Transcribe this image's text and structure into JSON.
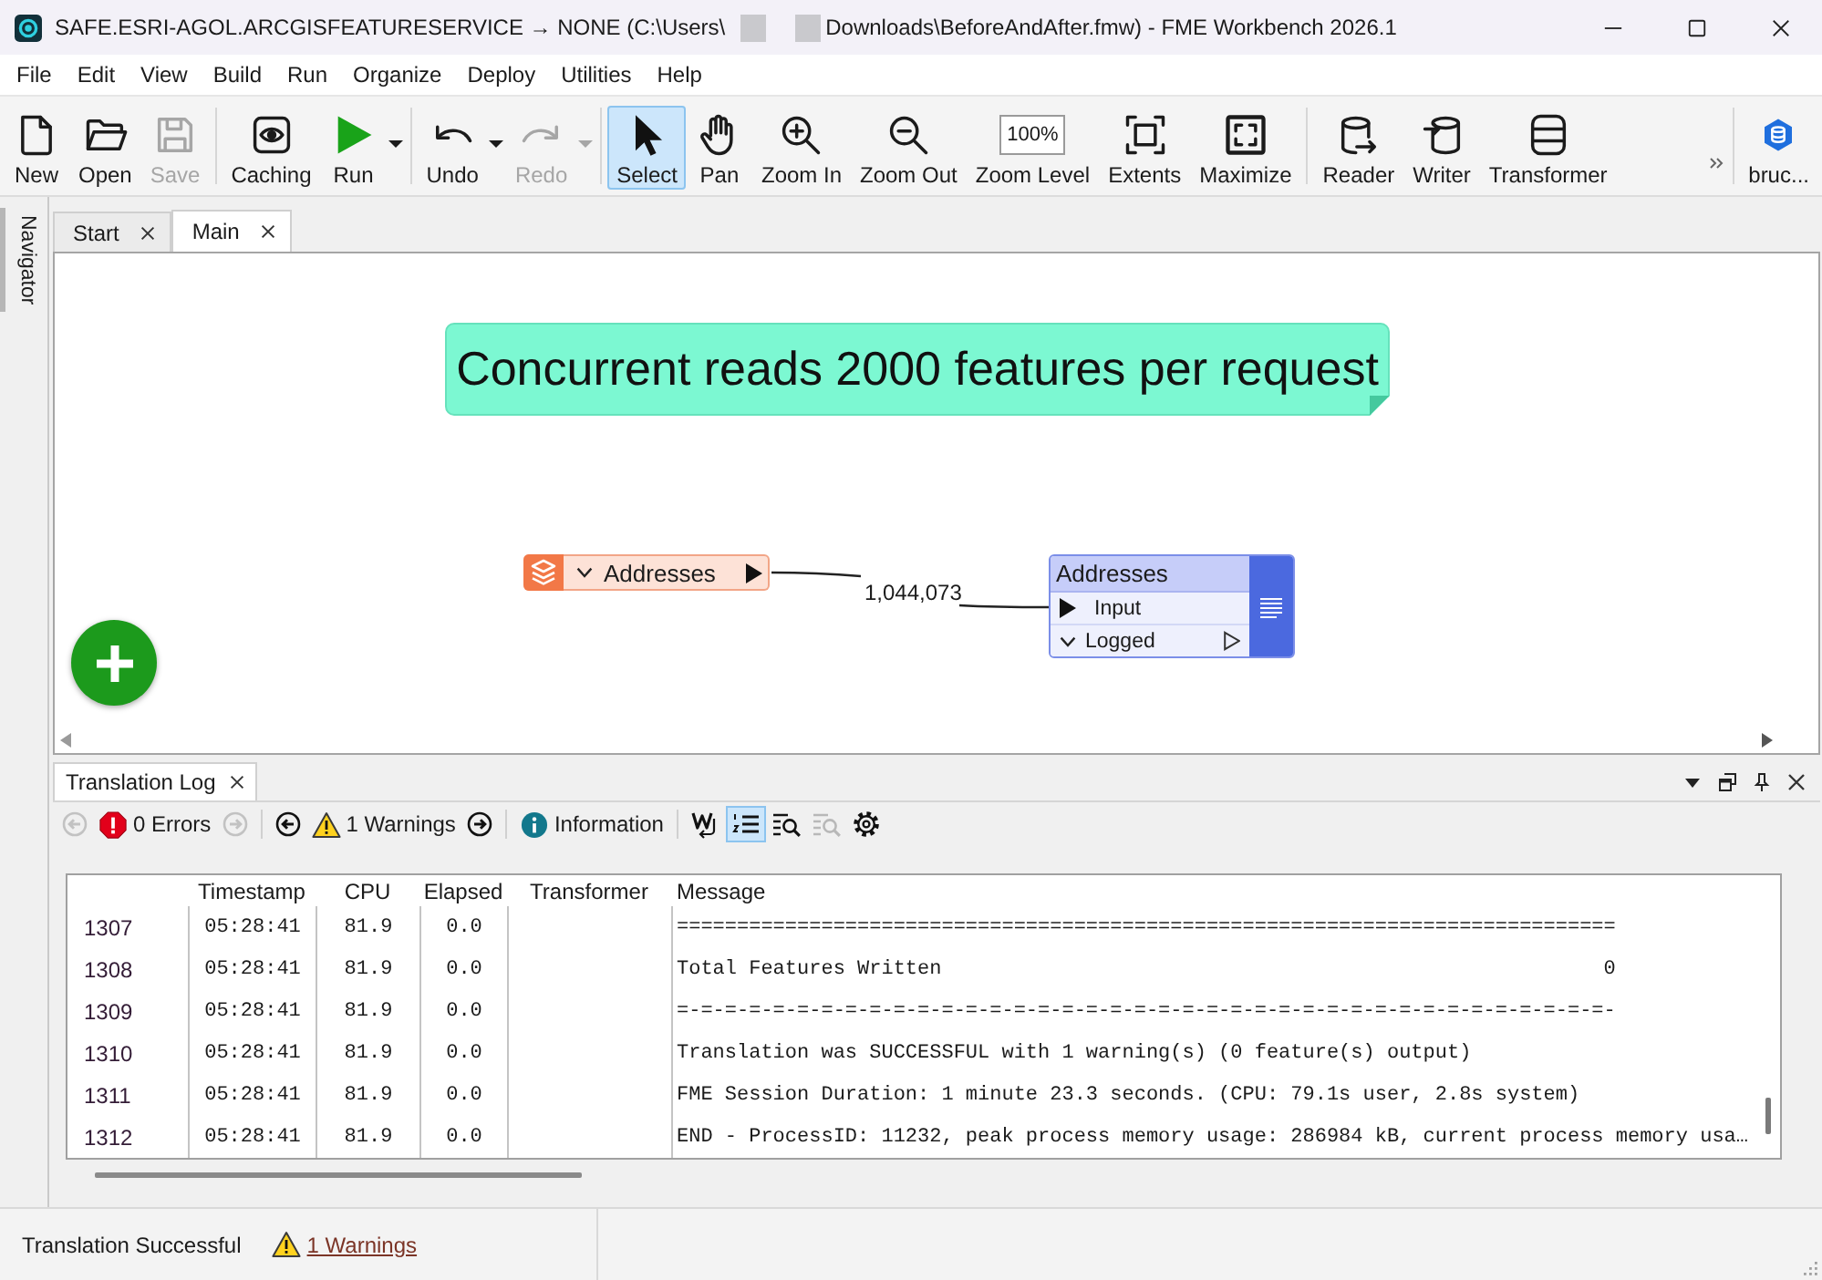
{
  "window": {
    "title_start": "SAFE.ESRI-AGOL.ARCGISFEATURESERVICE → NONE (C:\\Users\\",
    "title_end": "Downloads\\BeforeAndAfter.fmw) - FME Workbench 2026.1"
  },
  "menu": [
    "File",
    "Edit",
    "View",
    "Build",
    "Run",
    "Organize",
    "Deploy",
    "Utilities",
    "Help"
  ],
  "toolbar": {
    "groups": [
      [
        {
          "label": "New",
          "selected": false,
          "disabled": false,
          "dropdown": false
        },
        {
          "label": "Open",
          "selected": false,
          "disabled": false,
          "dropdown": false
        },
        {
          "label": "Save",
          "selected": false,
          "disabled": true,
          "dropdown": false
        }
      ],
      [
        {
          "label": "Caching",
          "selected": false,
          "disabled": false,
          "dropdown": false
        },
        {
          "label": "Run",
          "selected": false,
          "disabled": false,
          "dropdown": true
        }
      ],
      [
        {
          "label": "Undo",
          "selected": false,
          "disabled": false,
          "dropdown": true
        },
        {
          "label": "Redo",
          "selected": false,
          "disabled": true,
          "dropdown": true
        }
      ],
      [
        {
          "label": "Select",
          "selected": true,
          "disabled": false,
          "dropdown": false
        },
        {
          "label": "Pan",
          "selected": false,
          "disabled": false,
          "dropdown": false
        },
        {
          "label": "Zoom In",
          "selected": false,
          "disabled": false,
          "dropdown": false
        },
        {
          "label": "Zoom Out",
          "selected": false,
          "disabled": false,
          "dropdown": false
        },
        {
          "label": "Zoom Level",
          "value": "100%",
          "selected": false,
          "disabled": false,
          "dropdown": false
        },
        {
          "label": "Extents",
          "selected": false,
          "disabled": false,
          "dropdown": false
        },
        {
          "label": "Maximize",
          "selected": false,
          "disabled": false,
          "dropdown": false
        }
      ],
      [
        {
          "label": "Reader",
          "selected": false,
          "disabled": false,
          "dropdown": false
        },
        {
          "label": "Writer",
          "selected": false,
          "disabled": false,
          "dropdown": false
        },
        {
          "label": "Transformer",
          "selected": false,
          "disabled": false,
          "dropdown": false
        }
      ],
      [
        {
          "label": "bruc...",
          "selected": false,
          "disabled": false,
          "dropdown": false
        }
      ]
    ]
  },
  "navigator": {
    "label": "Navigator"
  },
  "document_tabs": [
    {
      "label": "Start",
      "selected": false
    },
    {
      "label": "Main",
      "selected": true
    }
  ],
  "canvas": {
    "annotation": "Concurrent reads 2000 features per request",
    "reader": {
      "name": "Addresses"
    },
    "connection": {
      "count": "1,044,073"
    },
    "writer": {
      "name": "Addresses",
      "ports": [
        {
          "kind": "input",
          "label": "Input"
        },
        {
          "kind": "output",
          "label": "Logged"
        }
      ]
    }
  },
  "log_panel": {
    "title": "Translation Log",
    "filters": [
      {
        "kind": "errors",
        "label": "0 Errors",
        "nav": {
          "disabled": true
        }
      },
      {
        "kind": "warnings",
        "label": "1 Warnings",
        "nav": {
          "disabled": false
        }
      },
      {
        "kind": "information",
        "label": "Information"
      }
    ],
    "tools": [
      {
        "selected": false,
        "disabled": false
      },
      {
        "selected": true,
        "disabled": false
      },
      {
        "selected": false,
        "disabled": false
      },
      {
        "selected": false,
        "disabled": true
      },
      {
        "selected": false,
        "disabled": false
      }
    ],
    "table": {
      "columns": [
        "Timestamp",
        "CPU",
        "Elapsed",
        "Transformer",
        "Message"
      ],
      "rows": [
        {
          "line": "1307",
          "timestamp": "05:28:41",
          "cpu": "81.9",
          "elapsed": "0.0",
          "message": "=============================================================================="
        },
        {
          "line": "1308",
          "timestamp": "05:28:41",
          "cpu": "81.9",
          "elapsed": "0.0",
          "message": "Total Features Written                                                       0"
        },
        {
          "line": "1309",
          "timestamp": "05:28:41",
          "cpu": "81.9",
          "elapsed": "0.0",
          "message": "=-=-=-=-=-=-=-=-=-=-=-=-=-=-=-=-=-=-=-=-=-=-=-=-=-=-=-=-=-=-=-=-=-=-=-=-=-=-=-"
        },
        {
          "line": "1310",
          "timestamp": "05:28:41",
          "cpu": "81.9",
          "elapsed": "0.0",
          "message": "Translation was SUCCESSFUL with 1 warning(s) (0 feature(s) output)"
        },
        {
          "line": "1311",
          "timestamp": "05:28:41",
          "cpu": "81.9",
          "elapsed": "0.0",
          "message": "FME Session Duration: 1 minute 23.3 seconds. (CPU: 79.1s user, 2.8s system)"
        },
        {
          "line": "1312",
          "timestamp": "05:28:41",
          "cpu": "81.9",
          "elapsed": "0.0",
          "message": "END - ProcessID: 11232, peak process memory usage: 286984 kB, current process memory usa…"
        }
      ]
    }
  },
  "status_bar": {
    "text": "Translation Successful",
    "warnings_link": "1 Warnings"
  }
}
